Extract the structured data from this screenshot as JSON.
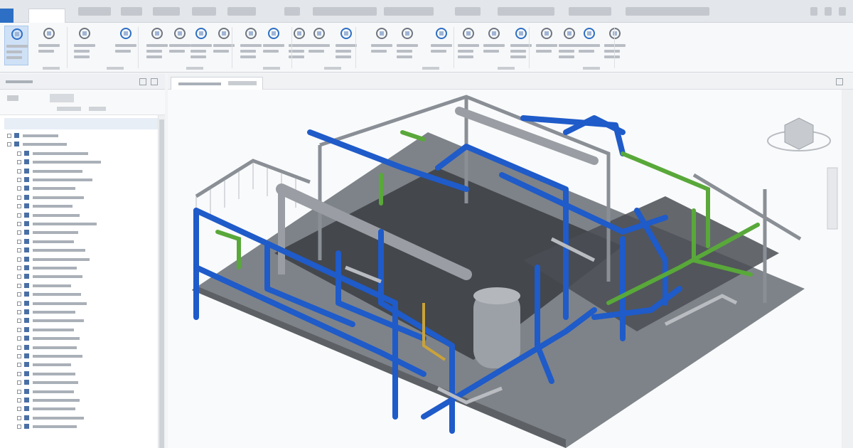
{
  "app": {
    "accent_color": "#2d6fc4",
    "pipe_colors": {
      "primary": "#1f5bc9",
      "secondary": "#59a83a",
      "steel": "#8a8f96",
      "accent": "#c9a23a"
    }
  },
  "icons": {
    "ribbon": [
      "select-icon",
      "bell-icon",
      "pipe-icon",
      "valve-icon",
      "fitting-icon",
      "equipment-icon",
      "structure-icon",
      "platform-icon",
      "ladder-icon",
      "nozzle-icon",
      "support-icon",
      "route-icon",
      "elbow-icon",
      "tee-icon",
      "flange-icon",
      "instrument-icon",
      "gauge-icon",
      "tag-icon",
      "ortho-icon",
      "iso-icon",
      "view-icon",
      "section-icon"
    ],
    "viewcube": "viewcube-icon"
  }
}
